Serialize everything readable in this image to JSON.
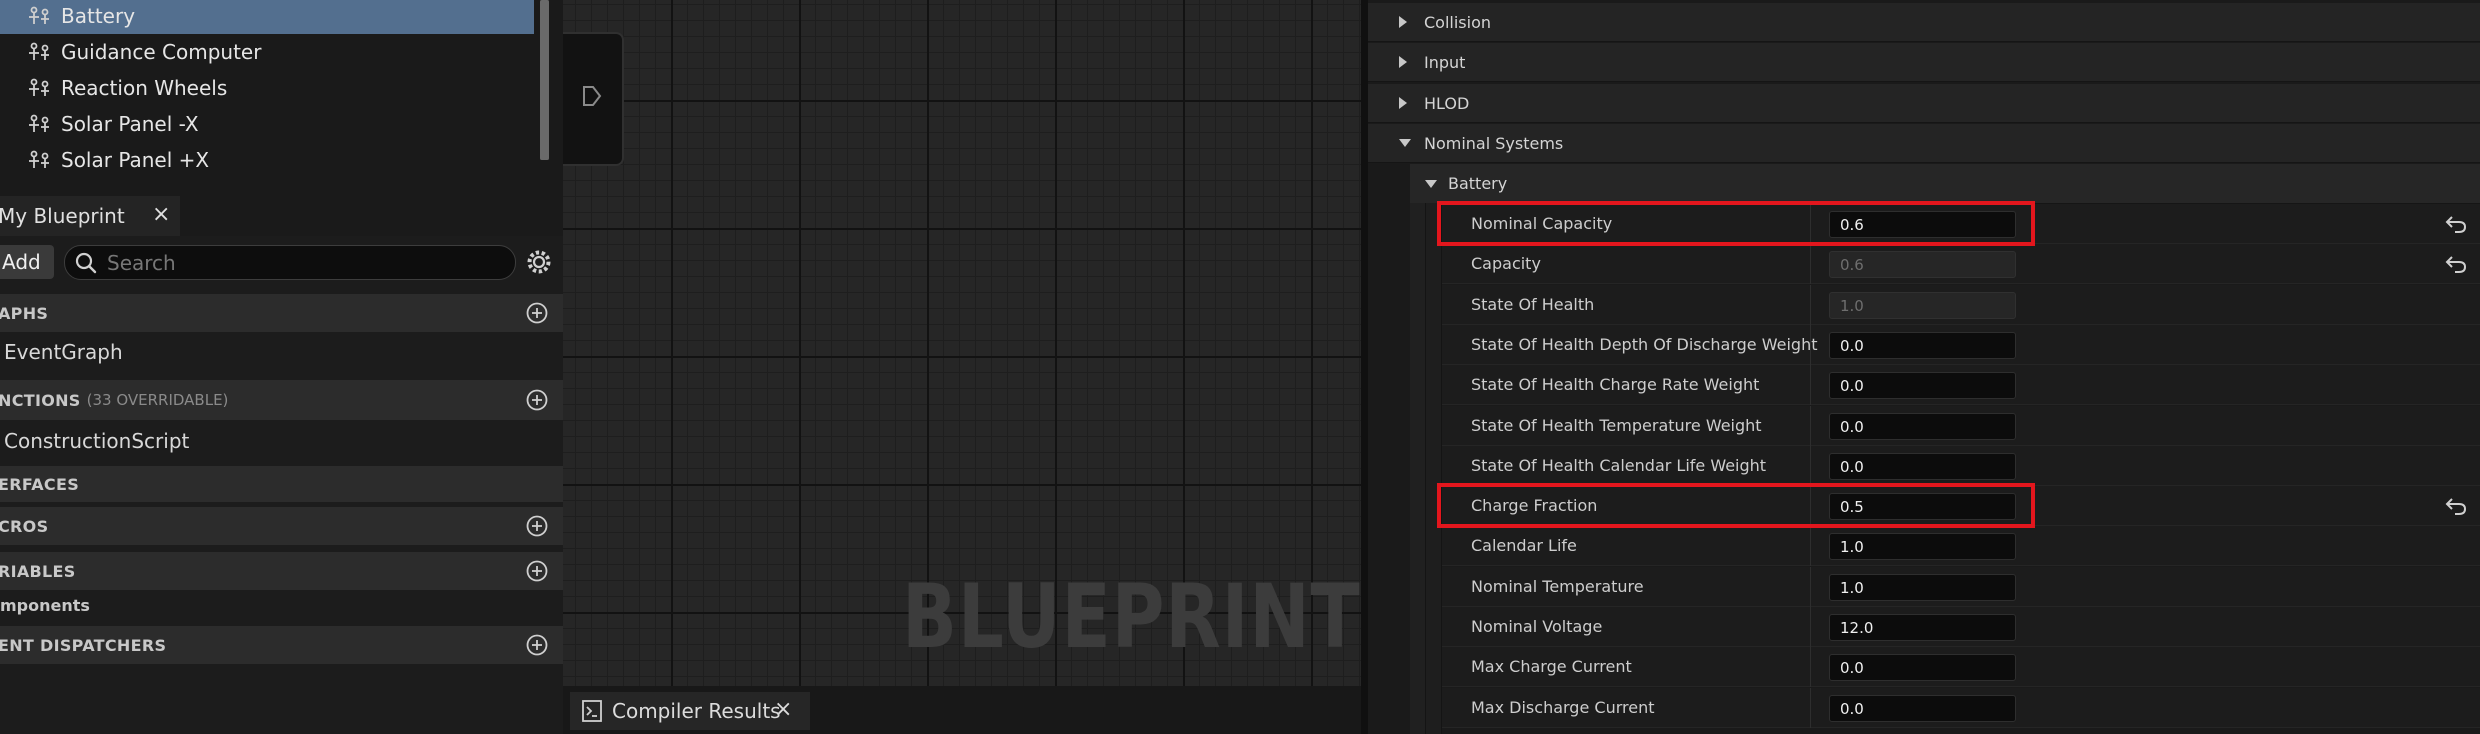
{
  "components": [
    {
      "label": "Battery",
      "selected": true,
      "icon": "component-icon"
    },
    {
      "label": "Guidance Computer",
      "selected": false,
      "icon": "component-icon"
    },
    {
      "label": "Reaction Wheels",
      "selected": false,
      "icon": "component-icon"
    },
    {
      "label": "Solar Panel -X",
      "selected": false,
      "icon": "component-icon"
    },
    {
      "label": "Solar Panel +X",
      "selected": false,
      "icon": "component-icon"
    }
  ],
  "my_blueprint": {
    "tab_label": "My Blueprint",
    "tab_close": "×",
    "add_label": "Add",
    "search_placeholder": "Search",
    "sections": {
      "graphs": "APHS",
      "event_graph": "EventGraph",
      "functions": "NCTIONS",
      "functions_sub": "(33 OVERRIDABLE)",
      "construction_script": "ConstructionScript",
      "interfaces": "ERFACES",
      "macros": "CROS",
      "variables": "RIABLES",
      "components": "mponents",
      "event_dispatchers": "ENT DISPATCHERS"
    }
  },
  "graph": {
    "watermark": "BLUEPRINT",
    "compiler_tab": "Compiler Results",
    "compiler_close": "×"
  },
  "details": {
    "categories": [
      "Collision",
      "Input",
      "HLOD",
      "Nominal Systems"
    ],
    "subcategory": "Battery",
    "properties": [
      {
        "name": "Nominal Capacity",
        "value": "0.6",
        "readonly": false,
        "reset": true,
        "highlight": true
      },
      {
        "name": "Capacity",
        "value": "0.6",
        "readonly": true,
        "reset": true,
        "highlight": false
      },
      {
        "name": "State Of Health",
        "value": "1.0",
        "readonly": true,
        "reset": false,
        "highlight": false
      },
      {
        "name": "State Of Health Depth Of Discharge Weight",
        "value": "0.0",
        "readonly": false,
        "reset": false,
        "highlight": false
      },
      {
        "name": "State Of Health Charge Rate Weight",
        "value": "0.0",
        "readonly": false,
        "reset": false,
        "highlight": false
      },
      {
        "name": "State Of Health Temperature Weight",
        "value": "0.0",
        "readonly": false,
        "reset": false,
        "highlight": false
      },
      {
        "name": "State Of Health Calendar Life Weight",
        "value": "0.0",
        "readonly": false,
        "reset": false,
        "highlight": false
      },
      {
        "name": "Charge Fraction",
        "value": "0.5",
        "readonly": false,
        "reset": true,
        "highlight": true
      },
      {
        "name": "Calendar Life",
        "value": "1.0",
        "readonly": false,
        "reset": false,
        "highlight": false
      },
      {
        "name": "Nominal Temperature",
        "value": "1.0",
        "readonly": false,
        "reset": false,
        "highlight": false
      },
      {
        "name": "Nominal Voltage",
        "value": "12.0",
        "readonly": false,
        "reset": false,
        "highlight": false
      },
      {
        "name": "Max Charge Current",
        "value": "0.0",
        "readonly": false,
        "reset": false,
        "highlight": false
      },
      {
        "name": "Max Discharge Current",
        "value": "0.0",
        "readonly": false,
        "reset": false,
        "highlight": false
      }
    ]
  },
  "colors": {
    "selection": "#536f8f",
    "highlight_box": "#e3161d"
  }
}
